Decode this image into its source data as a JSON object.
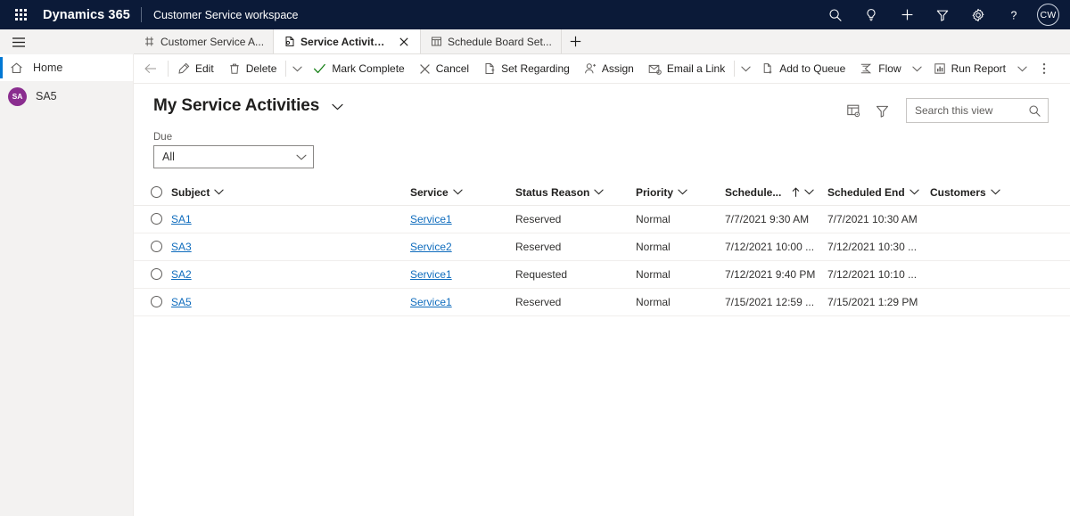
{
  "topnav": {
    "waffle_label": "app-launcher",
    "brand": "Dynamics 365",
    "app_name": "Customer Service workspace",
    "icons": [
      {
        "name": "search-icon",
        "title": "Search"
      },
      {
        "name": "lightbulb-icon",
        "title": "Assistant"
      },
      {
        "name": "plus-icon",
        "title": "Quick create"
      },
      {
        "name": "filter-icon",
        "title": "Filter"
      },
      {
        "name": "gear-icon",
        "title": "Settings"
      },
      {
        "name": "help-icon",
        "title": "Help"
      }
    ],
    "avatar_initials": "CW"
  },
  "tabs": [
    {
      "label": "Customer Service A...",
      "icon": "session-icon",
      "active": false,
      "closable": false
    },
    {
      "label": "Service Activities My Ser...",
      "icon": "activity-icon",
      "active": true,
      "closable": true
    },
    {
      "label": "Schedule Board Set...",
      "icon": "board-icon",
      "active": false,
      "closable": false
    }
  ],
  "tab_add_label": "+",
  "sidebar": {
    "hamburger": "site-map-toggle",
    "items": [
      {
        "label": "Home",
        "icon": "home-icon",
        "selected": true,
        "kind": "nav"
      },
      {
        "label": "SA5",
        "icon": "avatar",
        "selected": false,
        "kind": "session",
        "initials": "SA"
      }
    ]
  },
  "commandbar": {
    "back_label": "Back",
    "commands": [
      {
        "label": "Edit",
        "icon": "pencil-icon",
        "caret": false
      },
      {
        "label": "Delete",
        "icon": "trash-icon",
        "caret": false,
        "sep_after": true,
        "caret_after": true
      },
      {
        "label": "Mark Complete",
        "icon": "checkmark-icon",
        "caret": false
      },
      {
        "label": "Cancel",
        "icon": "cancel-x-icon",
        "caret": false
      },
      {
        "label": "Set Regarding",
        "icon": "set-regarding-icon",
        "caret": false
      },
      {
        "label": "Assign",
        "icon": "assign-person-icon",
        "caret": false
      },
      {
        "label": "Email a Link",
        "icon": "email-link-icon",
        "caret": false,
        "sep_after": true,
        "caret_after": true
      },
      {
        "label": "Add to Queue",
        "icon": "add-to-queue-icon",
        "caret": false
      },
      {
        "label": "Flow",
        "icon": "flow-icon",
        "caret": true
      },
      {
        "label": "Run Report",
        "icon": "run-report-icon",
        "caret": true
      }
    ],
    "overflow_label": "More commands"
  },
  "view": {
    "title": "My Service Activities",
    "title_caret": "view-selector",
    "tools": [
      {
        "name": "edit-columns-icon",
        "title": "Edit columns"
      },
      {
        "name": "edit-filters-icon",
        "title": "Edit filters"
      }
    ]
  },
  "search": {
    "placeholder": "Search this view",
    "value": "",
    "icon": "search-icon"
  },
  "filter": {
    "label": "Due",
    "value": "All",
    "options": [
      "All"
    ]
  },
  "grid": {
    "columns": [
      {
        "key": "check",
        "label": "",
        "sorted": false
      },
      {
        "key": "subject",
        "label": "Subject",
        "sorted": false
      },
      {
        "key": "service",
        "label": "Service",
        "sorted": false
      },
      {
        "key": "status",
        "label": "Status Reason",
        "sorted": false
      },
      {
        "key": "priority",
        "label": "Priority",
        "sorted": false
      },
      {
        "key": "schstart",
        "label": "Schedule...",
        "sorted": true,
        "sort_dir": "asc"
      },
      {
        "key": "schend",
        "label": "Scheduled End",
        "sorted": false
      },
      {
        "key": "customer",
        "label": "Customers",
        "sorted": false
      }
    ],
    "rows": [
      {
        "subject": "SA1",
        "service": "Service1",
        "status": "Reserved",
        "priority": "Normal",
        "schstart": "7/7/2021 9:30 AM",
        "schend": "7/7/2021 10:30 AM",
        "customer": ""
      },
      {
        "subject": "SA3",
        "service": "Service2",
        "status": "Reserved",
        "priority": "Normal",
        "schstart": "7/12/2021 10:00 ...",
        "schend": "7/12/2021 10:30 ...",
        "customer": ""
      },
      {
        "subject": "SA2",
        "service": "Service1",
        "status": "Requested",
        "priority": "Normal",
        "schstart": "7/12/2021 9:40 PM",
        "schend": "7/12/2021 10:10 ...",
        "customer": ""
      },
      {
        "subject": "SA5",
        "service": "Service1",
        "status": "Reserved",
        "priority": "Normal",
        "schstart": "7/15/2021 12:59 ...",
        "schend": "7/15/2021 1:29 PM",
        "customer": ""
      }
    ]
  },
  "colors": {
    "topnav_bg": "#0b1a38",
    "accent_blue": "#0078d4",
    "link_blue": "#0f6cbd",
    "success_green": "#107c10",
    "avatar_purple": "#8A2D8F",
    "sidebar_bg": "#f3f2f1"
  }
}
